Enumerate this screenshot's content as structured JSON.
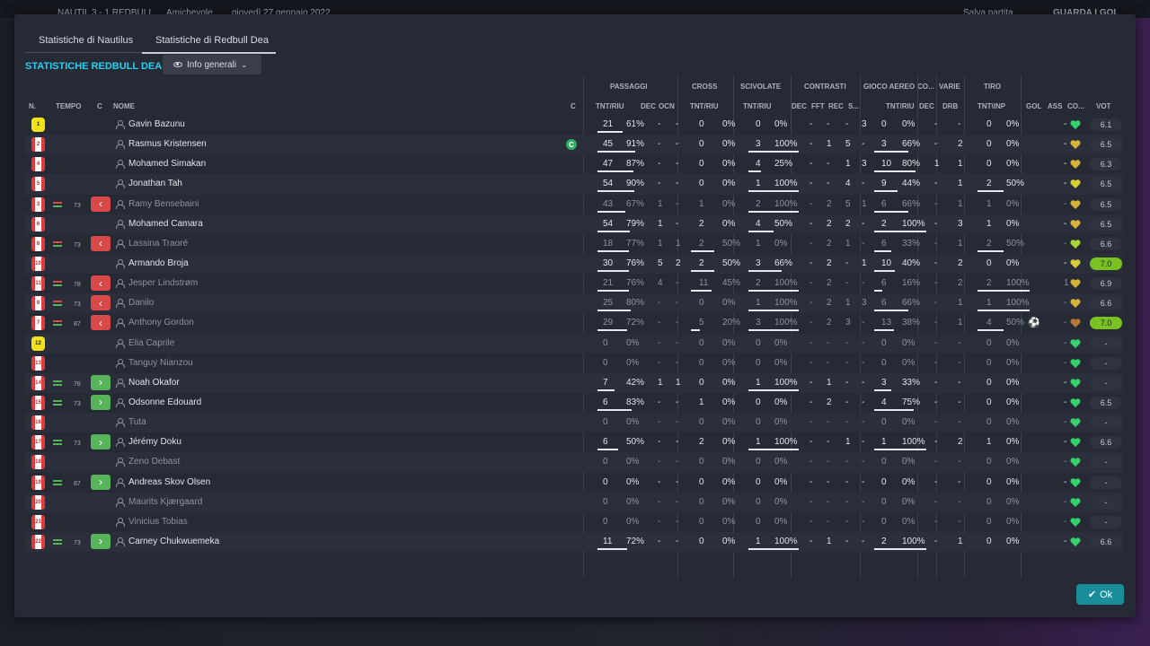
{
  "topbar": {
    "match": "NAUTIL  3 - 1  REDBULL",
    "type": "Amichevole",
    "date": "giovedì 27 gennaio 2022",
    "save": "Salva partita",
    "goals": "GUARDA I GOL"
  },
  "tabs": [
    "Statistiche di Nautilus",
    "Statistiche di Redbull Dea"
  ],
  "team_title": "STATISTICHE REDBULL DEA",
  "view_select": "Info generali",
  "groups": [
    "PASSAGGI",
    "CROSS",
    "SCIVOLATE",
    "CONTRASTI",
    "GIOCO AEREO",
    "CO...",
    "VARIE",
    "TIRO"
  ],
  "columns": [
    "N.",
    "TEMPO",
    "C",
    "NOME",
    "C",
    "TNT/RIU",
    "DEC",
    "OCN",
    "TNT/RIU",
    "TNT/RIU",
    "DEC",
    "FFT",
    "REC",
    "S...",
    "TNT/RIU",
    "DEC",
    "DRB",
    "TNT\\INP",
    "GOL",
    "ASS",
    "CO...",
    "VOT"
  ],
  "players": [
    {
      "num": "1",
      "kit": "yel",
      "sub": "",
      "min": "",
      "name": "Gavin Bazunu",
      "cap": "",
      "pass": "21",
      "passp": "61%",
      "pdec": "-",
      "pocn": "-",
      "cr": "0",
      "crp": "0%",
      "sc": "0",
      "scp": "0%",
      "cdec": "-",
      "fft": "-",
      "rec": "-",
      "s": "3",
      "ae": "0",
      "aep": "0%",
      "codec": "-",
      "drb": "-",
      "sh": "0",
      "shp": "0%",
      "gol": "",
      "ass": "-",
      "hc": "#35d16a",
      "vot": "6.1",
      "hi": false,
      "dim": false,
      "ball": false,
      "passbar": 0.61,
      "scbar": 0,
      "aebar": 0,
      "shbar": 0,
      "crbar": 0
    },
    {
      "num": "2",
      "kit": "red",
      "sub": "",
      "min": "",
      "name": "Rasmus Kristensen",
      "cap": "C",
      "pass": "45",
      "passp": "91%",
      "pdec": "-",
      "pocn": "-",
      "cr": "0",
      "crp": "0%",
      "sc": "3",
      "scp": "100%",
      "cdec": "-",
      "fft": "1",
      "rec": "5",
      "s": "-",
      "ae": "3",
      "aep": "66%",
      "codec": "-",
      "drb": "2",
      "sh": "0",
      "shp": "0%",
      "gol": "",
      "ass": "-",
      "hc": "#d6b338",
      "vot": "6.5",
      "hi": false,
      "dim": false,
      "ball": false,
      "passbar": 0.91,
      "scbar": 1,
      "aebar": 0.66,
      "shbar": 0,
      "crbar": 0
    },
    {
      "num": "4",
      "kit": "red",
      "sub": "",
      "min": "",
      "name": "Mohamed Simakan",
      "cap": "",
      "pass": "47",
      "passp": "87%",
      "pdec": "-",
      "pocn": "-",
      "cr": "0",
      "crp": "0%",
      "sc": "4",
      "scp": "25%",
      "cdec": "-",
      "fft": "-",
      "rec": "1",
      "s": "3",
      "ae": "10",
      "aep": "80%",
      "codec": "1",
      "drb": "1",
      "sh": "0",
      "shp": "0%",
      "gol": "",
      "ass": "-",
      "hc": "#d6b338",
      "vot": "6.3",
      "hi": false,
      "dim": false,
      "ball": false,
      "passbar": 0.87,
      "scbar": 0.25,
      "aebar": 0.8,
      "shbar": 0,
      "crbar": 0
    },
    {
      "num": "5",
      "kit": "red",
      "sub": "",
      "min": "",
      "name": "Jonathan Tah",
      "cap": "",
      "pass": "54",
      "passp": "90%",
      "pdec": "-",
      "pocn": "-",
      "cr": "0",
      "crp": "0%",
      "sc": "1",
      "scp": "100%",
      "cdec": "-",
      "fft": "-",
      "rec": "4",
      "s": "-",
      "ae": "9",
      "aep": "44%",
      "codec": "-",
      "drb": "1",
      "sh": "2",
      "shp": "50%",
      "gol": "",
      "ass": "-",
      "hc": "#d6cf35",
      "vot": "6.5",
      "hi": false,
      "dim": false,
      "ball": false,
      "passbar": 0.9,
      "scbar": 1,
      "aebar": 0.44,
      "shbar": 0.5,
      "crbar": 0
    },
    {
      "num": "3",
      "kit": "red",
      "sub": "out",
      "min": "73",
      "name": "Ramy Bensebaini",
      "cap": "",
      "pass": "43",
      "passp": "67%",
      "pdec": "1",
      "pocn": "-",
      "cr": "1",
      "crp": "0%",
      "sc": "2",
      "scp": "100%",
      "cdec": "-",
      "fft": "2",
      "rec": "5",
      "s": "1",
      "ae": "6",
      "aep": "66%",
      "codec": "-",
      "drb": "1",
      "sh": "1",
      "shp": "0%",
      "gol": "",
      "ass": "-",
      "hc": "#d6b338",
      "vot": "6.5",
      "hi": false,
      "dim": true,
      "ball": false,
      "passbar": 0.67,
      "scbar": 1,
      "aebar": 0.66,
      "shbar": 0,
      "crbar": 0
    },
    {
      "num": "6",
      "kit": "red",
      "sub": "",
      "min": "",
      "name": "Mohamed Camara",
      "cap": "",
      "pass": "54",
      "passp": "79%",
      "pdec": "1",
      "pocn": "-",
      "cr": "2",
      "crp": "0%",
      "sc": "4",
      "scp": "50%",
      "cdec": "-",
      "fft": "2",
      "rec": "2",
      "s": "-",
      "ae": "2",
      "aep": "100%",
      "codec": "-",
      "drb": "3",
      "sh": "1",
      "shp": "0%",
      "gol": "",
      "ass": "-",
      "hc": "#d6b338",
      "vot": "6.5",
      "hi": false,
      "dim": false,
      "ball": false,
      "passbar": 0.79,
      "scbar": 0.5,
      "aebar": 1,
      "shbar": 0,
      "crbar": 0
    },
    {
      "num": "8",
      "kit": "red",
      "sub": "out",
      "min": "73",
      "name": "Lassina Traoré",
      "cap": "",
      "pass": "18",
      "passp": "77%",
      "pdec": "1",
      "pocn": "1",
      "cr": "2",
      "crp": "50%",
      "sc": "1",
      "scp": "0%",
      "cdec": "-",
      "fft": "2",
      "rec": "1",
      "s": "-",
      "ae": "6",
      "aep": "33%",
      "codec": "-",
      "drb": "1",
      "sh": "2",
      "shp": "50%",
      "gol": "",
      "ass": "-",
      "hc": "#a9d635",
      "vot": "6.6",
      "hi": false,
      "dim": true,
      "ball": false,
      "passbar": 0.77,
      "scbar": 0,
      "aebar": 0.33,
      "shbar": 0.5,
      "crbar": 0.5
    },
    {
      "num": "10",
      "kit": "red",
      "sub": "",
      "min": "",
      "name": "Armando Broja",
      "cap": "",
      "pass": "30",
      "passp": "76%",
      "pdec": "5",
      "pocn": "2",
      "cr": "2",
      "crp": "50%",
      "sc": "3",
      "scp": "66%",
      "cdec": "-",
      "fft": "2",
      "rec": "-",
      "s": "1",
      "ae": "10",
      "aep": "40%",
      "codec": "-",
      "drb": "2",
      "sh": "0",
      "shp": "0%",
      "gol": "",
      "ass": "-",
      "hc": "#d6cf35",
      "vot": "7.0",
      "hi": true,
      "dim": false,
      "ball": false,
      "passbar": 0.76,
      "scbar": 0.66,
      "aebar": 0.4,
      "shbar": 0,
      "crbar": 0.5
    },
    {
      "num": "11",
      "kit": "red",
      "sub": "out",
      "min": "78",
      "name": "Jesper Lindstrøm",
      "cap": "",
      "pass": "21",
      "passp": "76%",
      "pdec": "4",
      "pocn": "-",
      "cr": "11",
      "crp": "45%",
      "sc": "2",
      "scp": "100%",
      "cdec": "-",
      "fft": "2",
      "rec": "-",
      "s": "-",
      "ae": "6",
      "aep": "16%",
      "codec": "-",
      "drb": "2",
      "sh": "2",
      "shp": "100%",
      "gol": "",
      "ass": "1",
      "hc": "#d6b338",
      "vot": "6.9",
      "hi": false,
      "dim": true,
      "ball": false,
      "passbar": 0.76,
      "scbar": 1,
      "aebar": 0.16,
      "shbar": 1,
      "crbar": 0.45
    },
    {
      "num": "9",
      "kit": "red",
      "sub": "out",
      "min": "73",
      "name": "Danilo",
      "cap": "",
      "pass": "25",
      "passp": "80%",
      "pdec": "-",
      "pocn": "-",
      "cr": "0",
      "crp": "0%",
      "sc": "1",
      "scp": "100%",
      "cdec": "-",
      "fft": "2",
      "rec": "1",
      "s": "3",
      "ae": "6",
      "aep": "66%",
      "codec": "-",
      "drb": "1",
      "sh": "1",
      "shp": "100%",
      "gol": "",
      "ass": "-",
      "hc": "#d6b338",
      "vot": "6.6",
      "hi": false,
      "dim": true,
      "ball": false,
      "passbar": 0.8,
      "scbar": 1,
      "aebar": 0.66,
      "shbar": 1,
      "crbar": 0
    },
    {
      "num": "7",
      "kit": "red",
      "sub": "out",
      "min": "87",
      "name": "Anthony Gordon",
      "cap": "",
      "pass": "29",
      "passp": "72%",
      "pdec": "-",
      "pocn": "-",
      "cr": "5",
      "crp": "20%",
      "sc": "3",
      "scp": "100%",
      "cdec": "-",
      "fft": "2",
      "rec": "3",
      "s": "-",
      "ae": "13",
      "aep": "38%",
      "codec": "-",
      "drb": "1",
      "sh": "4",
      "shp": "50%",
      "gol": "ball",
      "ass": "-",
      "hc": "#b57a3a",
      "vot": "7.0",
      "hi": true,
      "dim": true,
      "ball": true,
      "passbar": 0.72,
      "scbar": 1,
      "aebar": 0.38,
      "shbar": 0.5,
      "crbar": 0.2
    },
    {
      "num": "12",
      "kit": "yel",
      "sub": "",
      "min": "",
      "name": "Elia Caprile",
      "cap": "",
      "pass": "0",
      "passp": "0%",
      "pdec": "-",
      "pocn": "-",
      "cr": "0",
      "crp": "0%",
      "sc": "0",
      "scp": "0%",
      "cdec": "-",
      "fft": "-",
      "rec": "-",
      "s": "-",
      "ae": "0",
      "aep": "0%",
      "codec": "-",
      "drb": "-",
      "sh": "0",
      "shp": "0%",
      "gol": "",
      "ass": "-",
      "hc": "#35d16a",
      "vot": "-",
      "hi": false,
      "dim": true,
      "ball": false,
      "passbar": 0,
      "scbar": 0,
      "aebar": 0,
      "shbar": 0,
      "crbar": 0
    },
    {
      "num": "13",
      "kit": "red",
      "sub": "",
      "min": "",
      "name": "Tanguy Nianzou",
      "cap": "",
      "pass": "0",
      "passp": "0%",
      "pdec": "-",
      "pocn": "-",
      "cr": "0",
      "crp": "0%",
      "sc": "0",
      "scp": "0%",
      "cdec": "-",
      "fft": "-",
      "rec": "-",
      "s": "-",
      "ae": "0",
      "aep": "0%",
      "codec": "-",
      "drb": "-",
      "sh": "0",
      "shp": "0%",
      "gol": "",
      "ass": "-",
      "hc": "#35d16a",
      "vot": "-",
      "hi": false,
      "dim": true,
      "ball": false,
      "passbar": 0,
      "scbar": 0,
      "aebar": 0,
      "shbar": 0,
      "crbar": 0
    },
    {
      "num": "14",
      "kit": "red",
      "sub": "in",
      "min": "78",
      "name": "Noah Okafor",
      "cap": "",
      "pass": "7",
      "passp": "42%",
      "pdec": "1",
      "pocn": "1",
      "cr": "0",
      "crp": "0%",
      "sc": "1",
      "scp": "100%",
      "cdec": "-",
      "fft": "1",
      "rec": "-",
      "s": "-",
      "ae": "3",
      "aep": "33%",
      "codec": "-",
      "drb": "-",
      "sh": "0",
      "shp": "0%",
      "gol": "",
      "ass": "-",
      "hc": "#35d16a",
      "vot": "-",
      "hi": false,
      "dim": false,
      "ball": false,
      "passbar": 0.42,
      "scbar": 1,
      "aebar": 0.33,
      "shbar": 0,
      "crbar": 0
    },
    {
      "num": "15",
      "kit": "red",
      "sub": "in",
      "min": "73",
      "name": "Odsonne Edouard",
      "cap": "",
      "pass": "6",
      "passp": "83%",
      "pdec": "-",
      "pocn": "-",
      "cr": "1",
      "crp": "0%",
      "sc": "0",
      "scp": "0%",
      "cdec": "-",
      "fft": "2",
      "rec": "-",
      "s": "-",
      "ae": "4",
      "aep": "75%",
      "codec": "-",
      "drb": "-",
      "sh": "0",
      "shp": "0%",
      "gol": "",
      "ass": "-",
      "hc": "#35d16a",
      "vot": "6.5",
      "hi": false,
      "dim": false,
      "ball": false,
      "passbar": 0.83,
      "scbar": 0,
      "aebar": 0.75,
      "shbar": 0,
      "crbar": 0
    },
    {
      "num": "16",
      "kit": "red",
      "sub": "",
      "min": "",
      "name": "Tuta",
      "cap": "",
      "pass": "0",
      "passp": "0%",
      "pdec": "-",
      "pocn": "-",
      "cr": "0",
      "crp": "0%",
      "sc": "0",
      "scp": "0%",
      "cdec": "-",
      "fft": "-",
      "rec": "-",
      "s": "-",
      "ae": "0",
      "aep": "0%",
      "codec": "-",
      "drb": "-",
      "sh": "0",
      "shp": "0%",
      "gol": "",
      "ass": "-",
      "hc": "#35d16a",
      "vot": "-",
      "hi": false,
      "dim": true,
      "ball": false,
      "passbar": 0,
      "scbar": 0,
      "aebar": 0,
      "shbar": 0,
      "crbar": 0
    },
    {
      "num": "17",
      "kit": "red",
      "sub": "in",
      "min": "73",
      "name": "Jérémy Doku",
      "cap": "",
      "pass": "6",
      "passp": "50%",
      "pdec": "-",
      "pocn": "-",
      "cr": "2",
      "crp": "0%",
      "sc": "1",
      "scp": "100%",
      "cdec": "-",
      "fft": "-",
      "rec": "1",
      "s": "-",
      "ae": "1",
      "aep": "100%",
      "codec": "-",
      "drb": "2",
      "sh": "1",
      "shp": "0%",
      "gol": "",
      "ass": "-",
      "hc": "#35d16a",
      "vot": "6.6",
      "hi": false,
      "dim": false,
      "ball": false,
      "passbar": 0.5,
      "scbar": 1,
      "aebar": 1,
      "shbar": 0,
      "crbar": 0
    },
    {
      "num": "18",
      "kit": "red",
      "sub": "",
      "min": "",
      "name": "Zeno Debast",
      "cap": "",
      "pass": "0",
      "passp": "0%",
      "pdec": "-",
      "pocn": "-",
      "cr": "0",
      "crp": "0%",
      "sc": "0",
      "scp": "0%",
      "cdec": "-",
      "fft": "-",
      "rec": "-",
      "s": "-",
      "ae": "0",
      "aep": "0%",
      "codec": "-",
      "drb": "-",
      "sh": "0",
      "shp": "0%",
      "gol": "",
      "ass": "-",
      "hc": "#35d16a",
      "vot": "-",
      "hi": false,
      "dim": true,
      "ball": false,
      "passbar": 0,
      "scbar": 0,
      "aebar": 0,
      "shbar": 0,
      "crbar": 0
    },
    {
      "num": "19",
      "kit": "red",
      "sub": "in",
      "min": "87",
      "name": "Andreas Skov Olsen",
      "cap": "",
      "pass": "0",
      "passp": "0%",
      "pdec": "-",
      "pocn": "-",
      "cr": "0",
      "crp": "0%",
      "sc": "0",
      "scp": "0%",
      "cdec": "-",
      "fft": "-",
      "rec": "-",
      "s": "-",
      "ae": "0",
      "aep": "0%",
      "codec": "-",
      "drb": "-",
      "sh": "0",
      "shp": "0%",
      "gol": "",
      "ass": "-",
      "hc": "#35d16a",
      "vot": "-",
      "hi": false,
      "dim": false,
      "ball": false,
      "passbar": 0,
      "scbar": 0,
      "aebar": 0,
      "shbar": 0,
      "crbar": 0
    },
    {
      "num": "20",
      "kit": "red",
      "sub": "",
      "min": "",
      "name": "Maurits Kjærgaard",
      "cap": "",
      "pass": "0",
      "passp": "0%",
      "pdec": "-",
      "pocn": "-",
      "cr": "0",
      "crp": "0%",
      "sc": "0",
      "scp": "0%",
      "cdec": "-",
      "fft": "-",
      "rec": "-",
      "s": "-",
      "ae": "0",
      "aep": "0%",
      "codec": "-",
      "drb": "-",
      "sh": "0",
      "shp": "0%",
      "gol": "",
      "ass": "-",
      "hc": "#35d16a",
      "vot": "-",
      "hi": false,
      "dim": true,
      "ball": false,
      "passbar": 0,
      "scbar": 0,
      "aebar": 0,
      "shbar": 0,
      "crbar": 0
    },
    {
      "num": "21",
      "kit": "red",
      "sub": "",
      "min": "",
      "name": "Vinicius Tobias",
      "cap": "",
      "pass": "0",
      "passp": "0%",
      "pdec": "-",
      "pocn": "-",
      "cr": "0",
      "crp": "0%",
      "sc": "0",
      "scp": "0%",
      "cdec": "-",
      "fft": "-",
      "rec": "-",
      "s": "-",
      "ae": "0",
      "aep": "0%",
      "codec": "-",
      "drb": "-",
      "sh": "0",
      "shp": "0%",
      "gol": "",
      "ass": "-",
      "hc": "#35d16a",
      "vot": "-",
      "hi": false,
      "dim": true,
      "ball": false,
      "passbar": 0,
      "scbar": 0,
      "aebar": 0,
      "shbar": 0,
      "crbar": 0
    },
    {
      "num": "22",
      "kit": "red",
      "sub": "in",
      "min": "73",
      "name": "Carney Chukwuemeka",
      "cap": "",
      "pass": "11",
      "passp": "72%",
      "pdec": "-",
      "pocn": "-",
      "cr": "0",
      "crp": "0%",
      "sc": "1",
      "scp": "100%",
      "cdec": "-",
      "fft": "1",
      "rec": "-",
      "s": "-",
      "ae": "2",
      "aep": "100%",
      "codec": "-",
      "drb": "1",
      "sh": "0",
      "shp": "0%",
      "gol": "",
      "ass": "-",
      "hc": "#35d16a",
      "vot": "6.6",
      "hi": false,
      "dim": false,
      "ball": false,
      "passbar": 0.72,
      "scbar": 1,
      "aebar": 1,
      "shbar": 0,
      "crbar": 0
    }
  ],
  "ok_label": "Ok",
  "colors": {
    "accent": "#25d0f0",
    "ok": "#1a8d9a",
    "sub_out": "#d94949",
    "sub_in": "#58b45a",
    "rating_hi": "#7ac221"
  }
}
